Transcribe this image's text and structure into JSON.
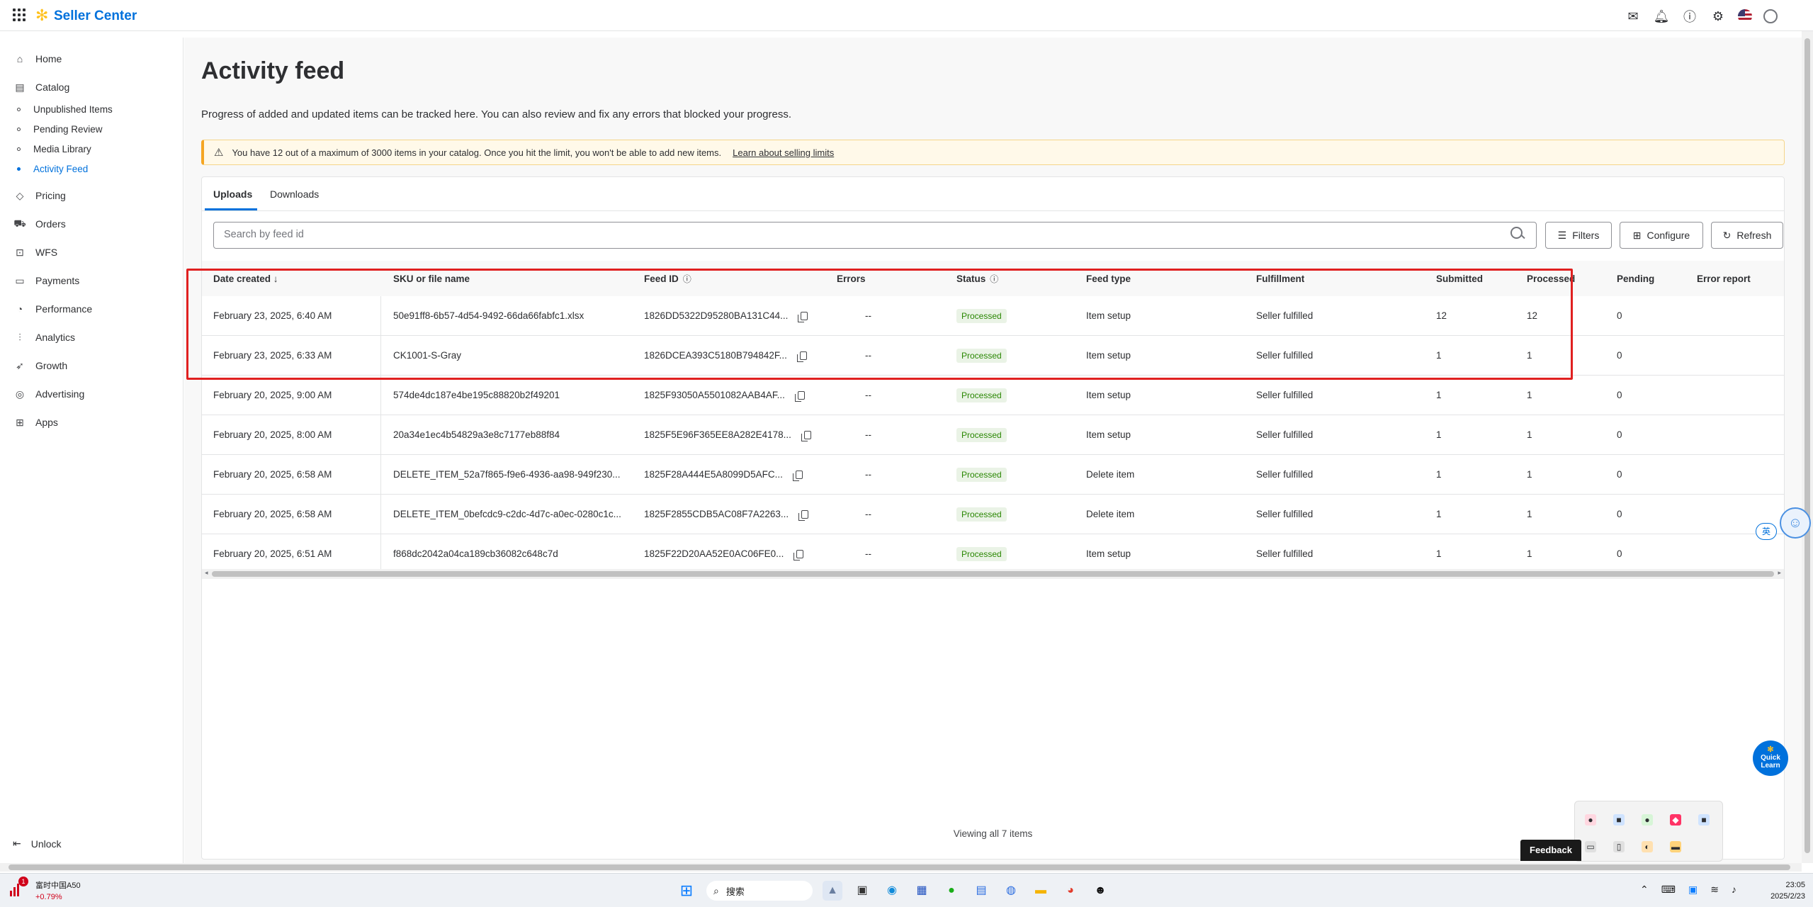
{
  "app": {
    "brand": "Seller Center"
  },
  "sidebar": {
    "items": [
      {
        "label": "Home",
        "icon": "home-icon"
      },
      {
        "label": "Catalog",
        "icon": "catalog-icon"
      },
      {
        "label": "Pricing",
        "icon": "tag-icon"
      },
      {
        "label": "Orders",
        "icon": "cart-icon"
      },
      {
        "label": "WFS",
        "icon": "truck-icon"
      },
      {
        "label": "Payments",
        "icon": "card-icon"
      },
      {
        "label": "Performance",
        "icon": "gauge-icon"
      },
      {
        "label": "Analytics",
        "icon": "chart-icon"
      },
      {
        "label": "Growth",
        "icon": "rocket-icon"
      },
      {
        "label": "Advertising",
        "icon": "target-icon"
      },
      {
        "label": "Apps",
        "icon": "apps-icon"
      }
    ],
    "catalog_sub": [
      "Unpublished Items",
      "Pending Review",
      "Media Library",
      "Activity Feed"
    ],
    "unlock": "Unlock"
  },
  "page": {
    "title": "Activity feed",
    "description": "Progress of added and updated items can be tracked here. You can also review and fix any errors that blocked your progress.",
    "alert_text": "You have 12 out of a maximum of 3000 items in your catalog. Once you hit the limit, you won't be able to add new items.",
    "alert_link": "Learn about selling limits"
  },
  "tabs": [
    "Uploads",
    "Downloads"
  ],
  "search": {
    "placeholder": "Search by feed id"
  },
  "toolbar": {
    "filters": "Filters",
    "configure": "Configure",
    "refresh": "Refresh"
  },
  "table": {
    "headers": [
      "Date created ↓",
      "SKU or file name",
      "Feed ID",
      "Errors",
      "Status",
      "Feed type",
      "Fulfillment",
      "Submitted",
      "Processed",
      "Pending",
      "Error report"
    ],
    "rows": [
      {
        "date": "February 23, 2025, 6:40 AM",
        "sku": "50e91ff8-6b57-4d54-9492-66da66fabfc1.xlsx",
        "feed_id": "1826DD5322D95280BA131C44...",
        "errors": "--",
        "status": "Processed",
        "feed_type": "Item setup",
        "fulfillment": "Seller fulfilled",
        "submitted": "12",
        "processed": "12",
        "pending": "0"
      },
      {
        "date": "February 23, 2025, 6:33 AM",
        "sku": "CK1001-S-Gray",
        "feed_id": "1826DCEA393C5180B794842F...",
        "errors": "--",
        "status": "Processed",
        "feed_type": "Item setup",
        "fulfillment": "Seller fulfilled",
        "submitted": "1",
        "processed": "1",
        "pending": "0"
      },
      {
        "date": "February 20, 2025, 9:00 AM",
        "sku": "574de4dc187e4be195c88820b2f49201",
        "feed_id": "1825F93050A5501082AAB4AF...",
        "errors": "--",
        "status": "Processed",
        "feed_type": "Item setup",
        "fulfillment": "Seller fulfilled",
        "submitted": "1",
        "processed": "1",
        "pending": "0"
      },
      {
        "date": "February 20, 2025, 8:00 AM",
        "sku": "20a34e1ec4b54829a3e8c7177eb88f84",
        "feed_id": "1825F5E96F365EE8A282E4178...",
        "errors": "--",
        "status": "Processed",
        "feed_type": "Item setup",
        "fulfillment": "Seller fulfilled",
        "submitted": "1",
        "processed": "1",
        "pending": "0"
      },
      {
        "date": "February 20, 2025, 6:58 AM",
        "sku": "DELETE_ITEM_52a7f865-f9e6-4936-aa98-949f230...",
        "feed_id": "1825F28A444E5A8099D5AFC...",
        "errors": "--",
        "status": "Processed",
        "feed_type": "Delete item",
        "fulfillment": "Seller fulfilled",
        "submitted": "1",
        "processed": "1",
        "pending": "0"
      },
      {
        "date": "February 20, 2025, 6:58 AM",
        "sku": "DELETE_ITEM_0befcdc9-c2dc-4d7c-a0ec-0280c1c...",
        "feed_id": "1825F2855CDB5AC08F7A2263...",
        "errors": "--",
        "status": "Processed",
        "feed_type": "Delete item",
        "fulfillment": "Seller fulfilled",
        "submitted": "1",
        "processed": "1",
        "pending": "0"
      },
      {
        "date": "February 20, 2025, 6:51 AM",
        "sku": "f868dc2042a04ca189cb36082c648c7d",
        "feed_id": "1825F22D20AA52E0AC06FE0...",
        "errors": "--",
        "status": "Processed",
        "feed_type": "Item setup",
        "fulfillment": "Seller fulfilled",
        "submitted": "1",
        "processed": "1",
        "pending": "0"
      }
    ],
    "footer": "Viewing all 7 items"
  },
  "floating": {
    "lang": "英",
    "quick_learn": "Quick Learn",
    "feedback": "Feedback"
  },
  "taskbar": {
    "stock_name": "富时中国A50",
    "stock_change": "+0.79%",
    "stock_badge": "1",
    "search_label": "搜索",
    "time": "23:05",
    "date": "2025/2/23"
  },
  "colors": {
    "accent": "#0071dc",
    "spark": "#ffc220",
    "highlight": "#e02020",
    "status_bg": "#eaf3e6",
    "status_text": "#2a8703"
  }
}
